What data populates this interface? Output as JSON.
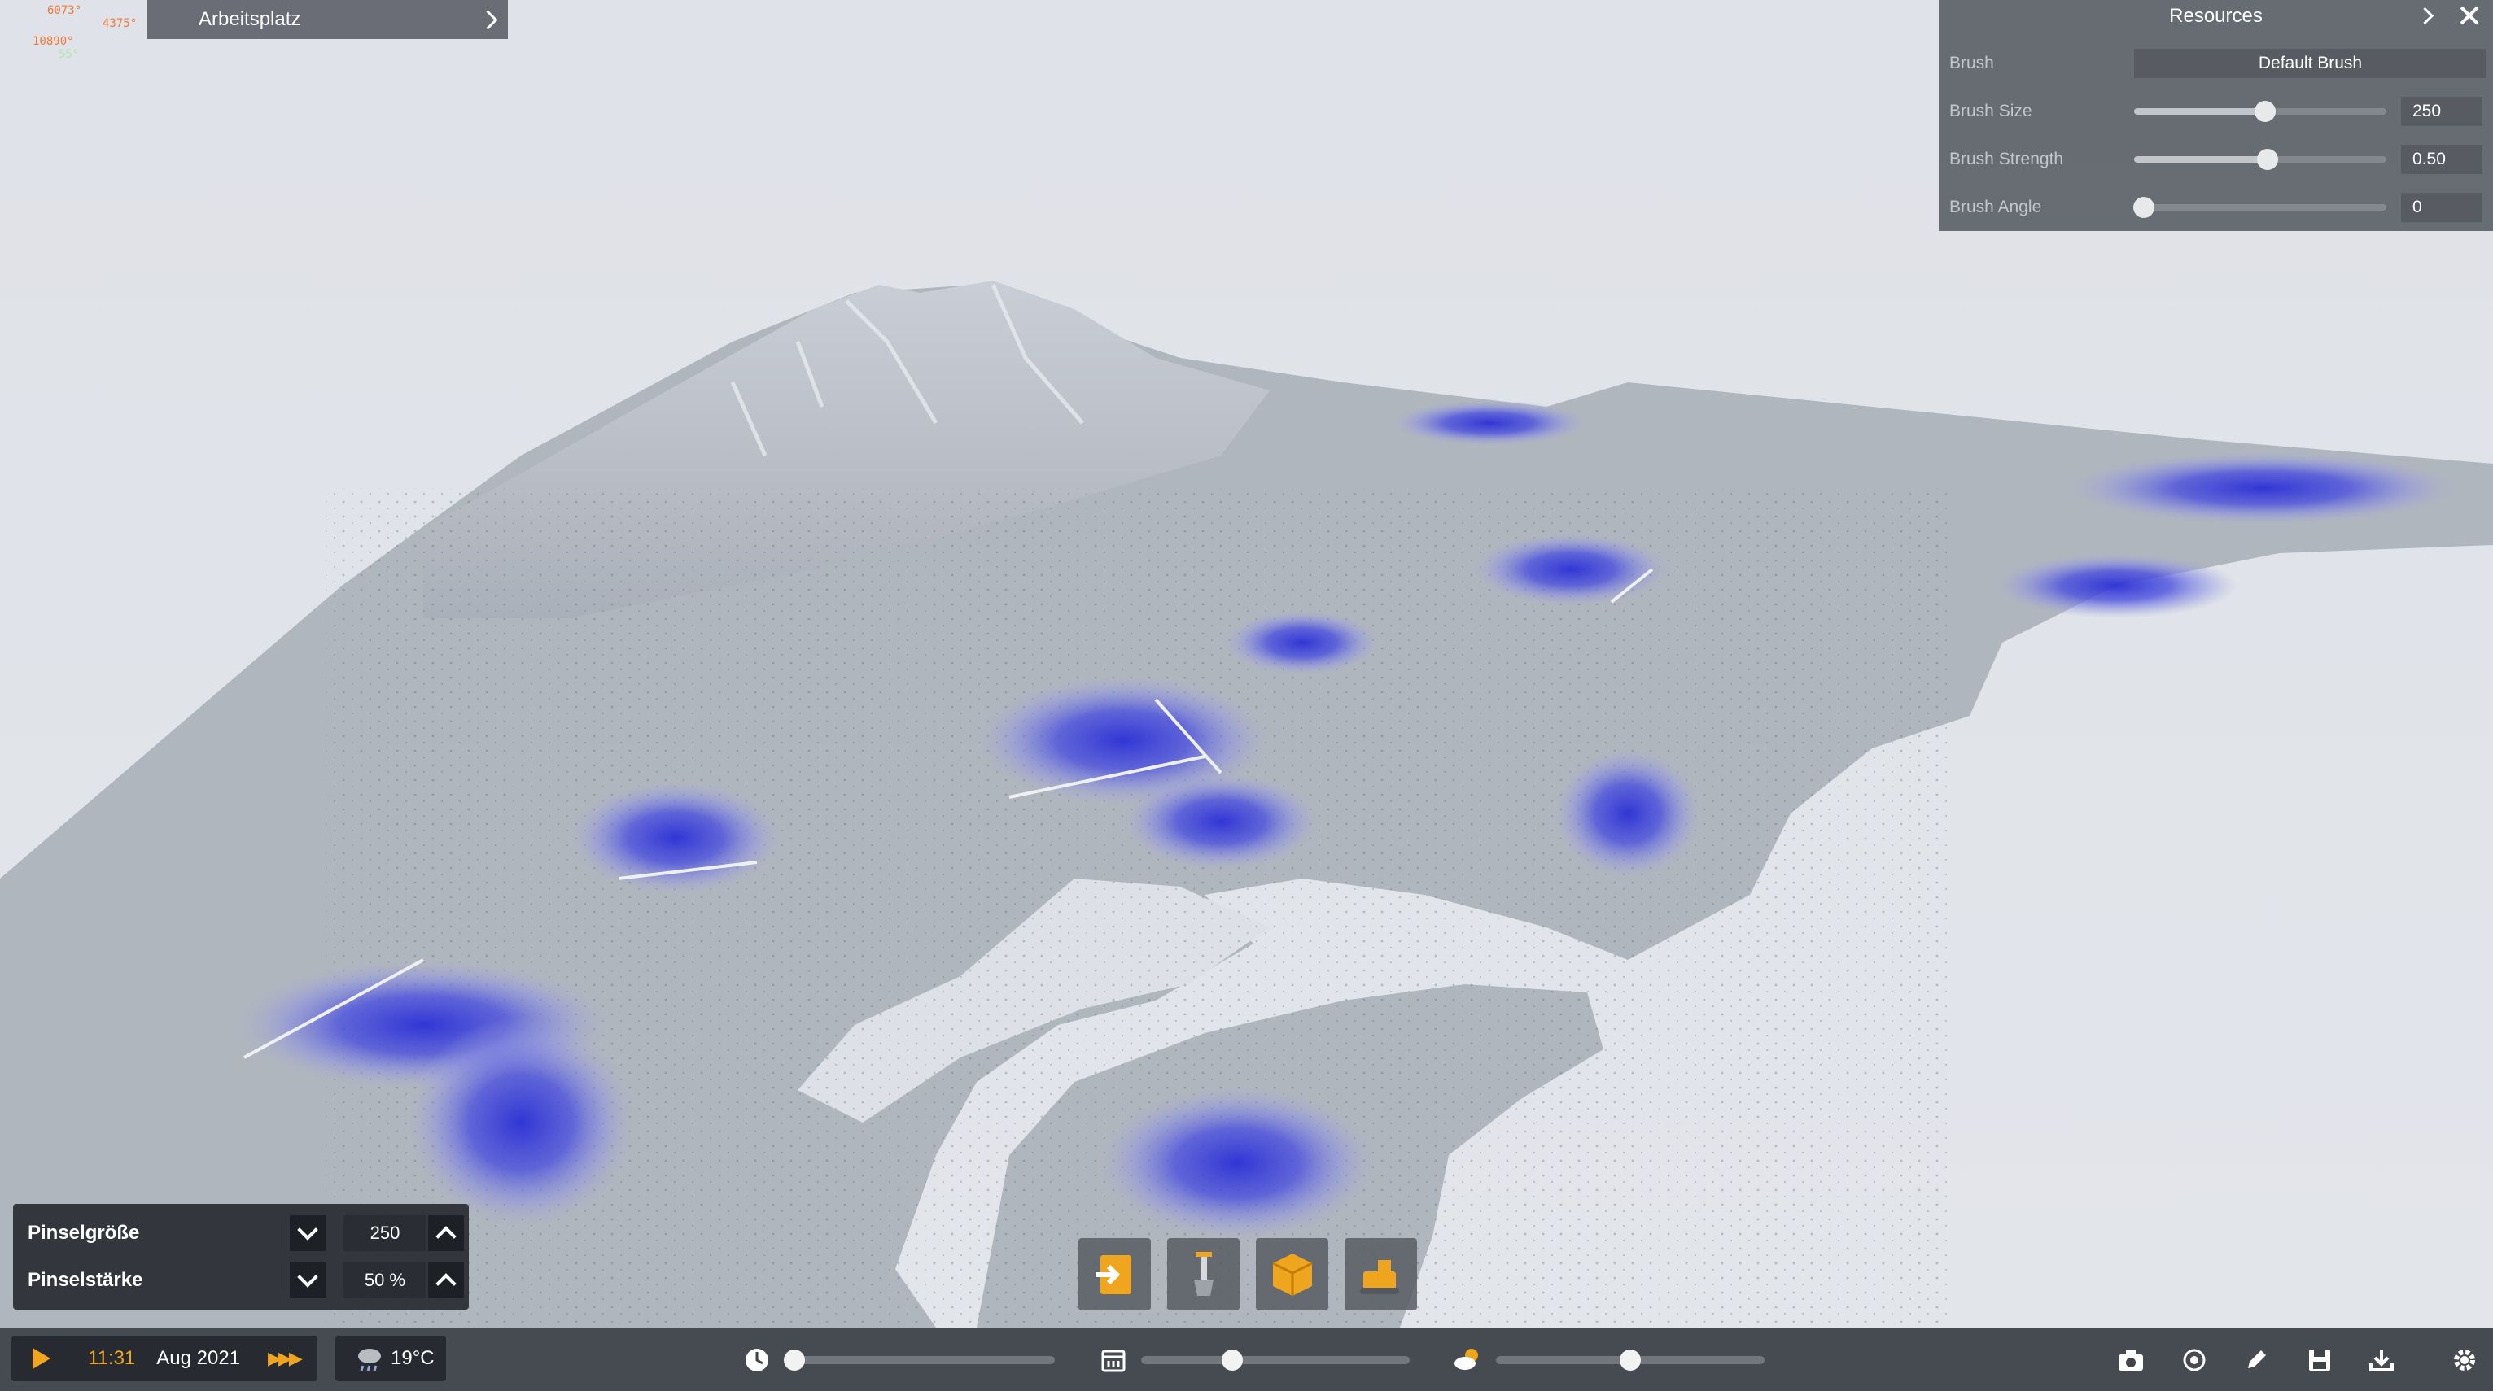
{
  "debug_overlay": {
    "lines": [
      "6073°",
      "4375°",
      "10890°",
      "55°"
    ]
  },
  "workspace": {
    "label": "Arbeitsplatz"
  },
  "resources": {
    "title": "Resources",
    "brush_label": "Brush",
    "brush_value": "Default Brush",
    "sliders": [
      {
        "label": "Brush Size",
        "value": "250",
        "level": 0.52
      },
      {
        "label": "Brush Strength",
        "value": "0.50",
        "level": 0.53
      },
      {
        "label": "Brush Angle",
        "value": "0",
        "level": 0.04
      }
    ]
  },
  "brush_panel": {
    "size_label": "Pinselgröße",
    "size_value": "250",
    "strength_label": "Pinselstärke",
    "strength_value": "50 %"
  },
  "bottom_bar": {
    "time": "11:31",
    "date": "Aug 2021",
    "temperature": "19°C",
    "time_of_day_level": 0.0,
    "date_level": 0.34,
    "weather_level": 0.5
  },
  "colors": {
    "accent": "#f0a51e",
    "resource_heat": "#3a3fd8",
    "panel": "#60646b",
    "bar": "#40444a"
  },
  "icons": {
    "tools": [
      "import-terrain-icon",
      "shovel-icon",
      "resource-box-icon",
      "bulldozer-icon"
    ],
    "bottom_right": [
      "camera-icon",
      "target-icon",
      "pencil-icon",
      "save-icon",
      "download-icon",
      "gear-icon"
    ]
  }
}
